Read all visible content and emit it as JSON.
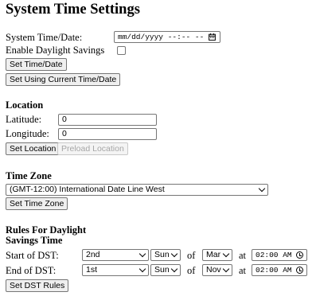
{
  "page_title": "System Time Settings",
  "system_time": {
    "date_label": "System Time/Date:",
    "datetime_placeholder": "mm/dd/yyyy --:-- --",
    "daylight_label": "Enable Daylight Savings",
    "daylight_checked": false,
    "set_button": "Set Time/Date",
    "set_current_button": "Set Using Current Time/Date"
  },
  "location": {
    "heading": "Location",
    "latitude_label": "Latitude:",
    "latitude_value": "0",
    "longitude_label": "Longitude:",
    "longitude_value": "0",
    "set_button": "Set Location",
    "preload_button": "Preload Location"
  },
  "time_zone": {
    "heading": "Time Zone",
    "selected": "(GMT-12:00) International Date Line West",
    "set_button": "Set Time Zone"
  },
  "dst_rules": {
    "heading_line1": "Rules For Daylight",
    "heading_line2": "Savings Time",
    "word_of": "of",
    "word_at": "at",
    "start": {
      "label": "Start of DST:",
      "week": "2nd",
      "day": "Sun",
      "month": "Mar",
      "time": "02:00 AM"
    },
    "end": {
      "label": "End of DST:",
      "week": "1st",
      "day": "Sun",
      "month": "Nov",
      "time": "02:00 AM"
    },
    "set_button": "Set DST Rules"
  },
  "icons": {
    "calendar": "calendar-icon",
    "clock": "clock-icon",
    "dropdown": "chevron-down-icon"
  }
}
